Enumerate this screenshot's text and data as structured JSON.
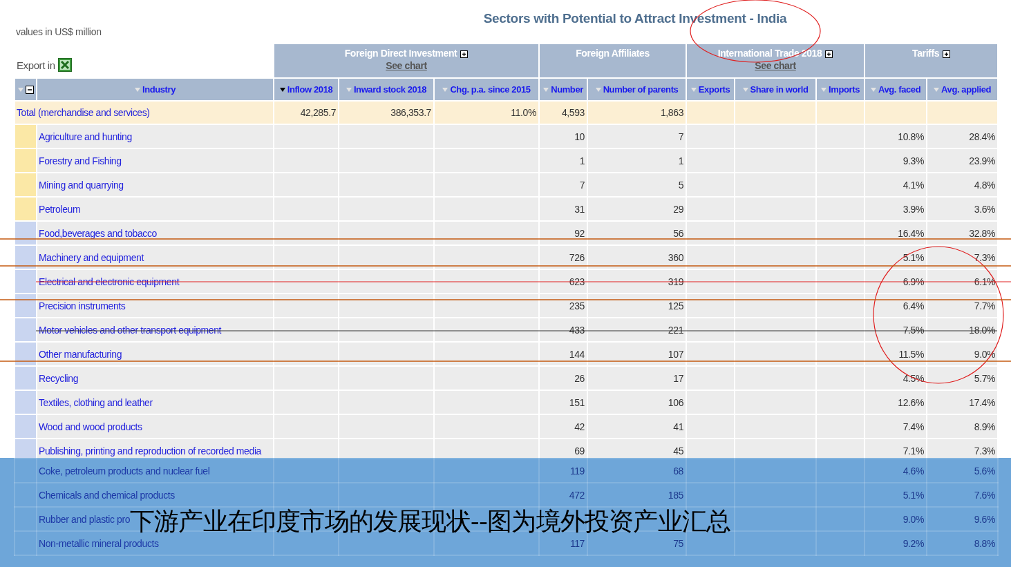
{
  "title": "Sectors with Potential to Attract Investment - India",
  "units_note": "values in US$ million",
  "export_label": "Export in",
  "groups": [
    {
      "label": "Foreign Direct Investment",
      "expandable": true,
      "see_chart": "See chart"
    },
    {
      "label": "Foreign Affiliates",
      "expandable": false
    },
    {
      "label": "International Trade 2018",
      "expandable": true,
      "see_chart": "See chart"
    },
    {
      "label": "Tariffs",
      "expandable": true
    }
  ],
  "columns": [
    {
      "label": "Industry",
      "sorted": false
    },
    {
      "label": "Inflow 2018",
      "sorted": true
    },
    {
      "label": "Inward stock 2018",
      "sorted": false
    },
    {
      "label": "Chg. p.a. since 2015",
      "sorted": false
    },
    {
      "label": "Number",
      "sorted": false
    },
    {
      "label": "Number of parents",
      "sorted": false
    },
    {
      "label": "Exports",
      "sorted": false
    },
    {
      "label": "Share in world",
      "sorted": false
    },
    {
      "label": "Imports",
      "sorted": false
    },
    {
      "label": "Avg. faced",
      "sorted": false
    },
    {
      "label": "Avg. applied",
      "sorted": false
    }
  ],
  "total_row": {
    "industry": "Total (merchandise and services)",
    "inflow": "42,285.7",
    "inward_stock": "386,353.7",
    "change": "11.0%",
    "number": "4,593",
    "parents": "1,863"
  },
  "rows": [
    {
      "industry": "Agriculture and hunting",
      "color": "#fbe8a6",
      "number": "10",
      "parents": "7",
      "avg_faced": "10.8%",
      "avg_applied": "28.4%"
    },
    {
      "industry": "Forestry and Fishing",
      "color": "#fbe8a6",
      "number": "1",
      "parents": "1",
      "avg_faced": "9.3%",
      "avg_applied": "23.9%"
    },
    {
      "industry": "Mining and quarrying",
      "color": "#fbe8a6",
      "number": "7",
      "parents": "5",
      "avg_faced": "4.1%",
      "avg_applied": "4.8%"
    },
    {
      "industry": "Petroleum",
      "color": "#fbe8a6",
      "number": "31",
      "parents": "29",
      "avg_faced": "3.9%",
      "avg_applied": "3.6%"
    },
    {
      "industry": "Food,beverages and tobacco",
      "color": "#c9d5f0",
      "number": "92",
      "parents": "56",
      "avg_faced": "16.4%",
      "avg_applied": "32.8%"
    },
    {
      "industry": "Machinery and equipment",
      "color": "#c9d5f0",
      "number": "726",
      "parents": "360",
      "avg_faced": "5.1%",
      "avg_applied": "7.3%"
    },
    {
      "industry": "Electrical and electronic equipment",
      "color": "#c9d5f0",
      "number": "623",
      "parents": "319",
      "avg_faced": "6.9%",
      "avg_applied": "6.1%"
    },
    {
      "industry": "Precision instruments",
      "color": "#c9d5f0",
      "number": "235",
      "parents": "125",
      "avg_faced": "6.4%",
      "avg_applied": "7.7%"
    },
    {
      "industry": "Motor vehicles and other transport equipment",
      "color": "#c9d5f0",
      "number": "433",
      "parents": "221",
      "avg_faced": "7.5%",
      "avg_applied": "18.0%"
    },
    {
      "industry": "Other manufacturing",
      "color": "#c9d5f0",
      "number": "144",
      "parents": "107",
      "avg_faced": "11.5%",
      "avg_applied": "9.0%"
    },
    {
      "industry": "Recycling",
      "color": "#c9d5f0",
      "number": "26",
      "parents": "17",
      "avg_faced": "4.5%",
      "avg_applied": "5.7%"
    },
    {
      "industry": "Textiles, clothing and leather",
      "color": "#c9d5f0",
      "number": "151",
      "parents": "106",
      "avg_faced": "12.6%",
      "avg_applied": "17.4%"
    },
    {
      "industry": "Wood and wood products",
      "color": "#c9d5f0",
      "number": "42",
      "parents": "41",
      "avg_faced": "7.4%",
      "avg_applied": "8.9%"
    },
    {
      "industry": "Publishing, printing and reproduction of recorded media",
      "color": "#c9d5f0",
      "number": "69",
      "parents": "45",
      "avg_faced": "7.1%",
      "avg_applied": "7.3%"
    }
  ],
  "banner": {
    "rows_under_banner": [
      {
        "industry": "Coke, petroleum products and nuclear fuel",
        "number": "119",
        "parents": "68",
        "avg_faced": "4.6%",
        "avg_applied": "5.6%"
      },
      {
        "industry": "Chemicals and chemical products",
        "number": "472",
        "parents": "185",
        "avg_faced": "5.1%",
        "avg_applied": "7.6%"
      },
      {
        "industry": "Rubber and plastic pro",
        "avg_faced": "9.0%",
        "avg_applied": "9.6%"
      },
      {
        "industry": "Non-metallic mineral products",
        "number": "117",
        "parents": "75",
        "avg_faced": "9.2%",
        "avg_applied": "8.8%"
      }
    ],
    "caption": "下游产业在印度市场的发展现状--图为境外投资产业汇总"
  }
}
